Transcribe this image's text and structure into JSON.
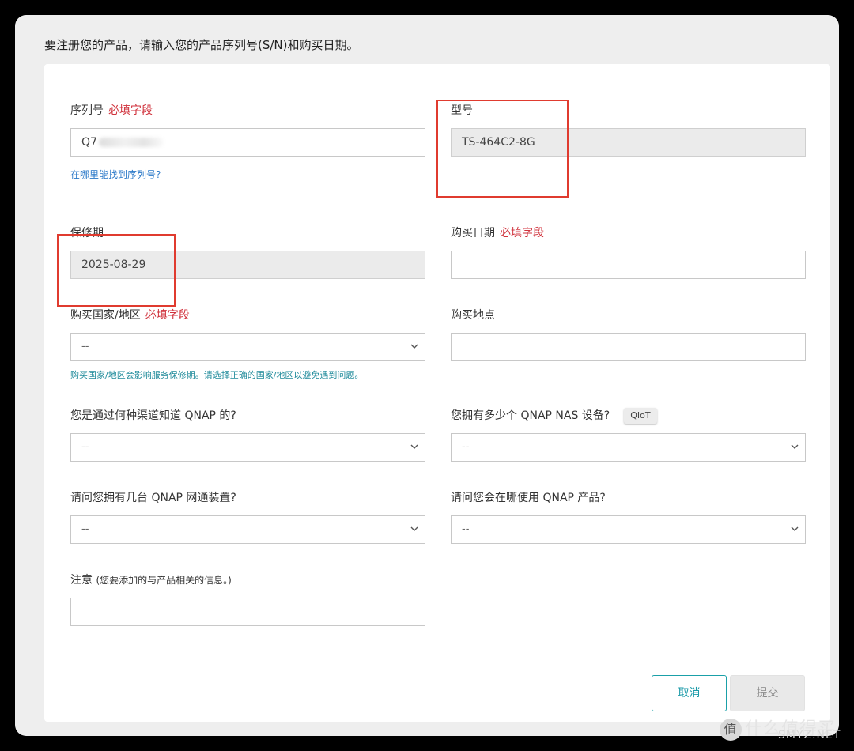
{
  "intro": "要注册您的产品，请输入您的产品序列号(S/N)和购买日期。",
  "required_tag": "必填字段",
  "serial": {
    "label": "序列号",
    "value": "Q7",
    "help_link": "在哪里能找到序列号?"
  },
  "model": {
    "label": "型号",
    "value": "TS-464C2-8G"
  },
  "warranty": {
    "label": "保修期",
    "value": "2025-08-29"
  },
  "purchase_date": {
    "label": "购买日期",
    "value": ""
  },
  "purchase_country": {
    "label": "购买国家/地区",
    "value": "--",
    "hint": "购买国家/地区会影响服务保修期。请选择正确的国家/地区以避免遇到问题。"
  },
  "purchase_place": {
    "label": "购买地点",
    "value": ""
  },
  "channel": {
    "label": "您是通过何种渠道知道 QNAP 的?",
    "value": "--"
  },
  "nas_count": {
    "label": "您拥有多少个 QNAP NAS 设备?",
    "badge": "QIoT",
    "value": "--"
  },
  "network_count": {
    "label": "请问您拥有几台 QNAP 网通装置?",
    "value": "--"
  },
  "usage_place": {
    "label": "请问您会在哪使用 QNAP 产品?",
    "value": "--"
  },
  "notes": {
    "label": "注意",
    "sub": "(您要添加的与产品相关的信息。)",
    "value": ""
  },
  "buttons": {
    "cancel": "取消",
    "submit": "提交"
  },
  "watermark": {
    "logo": "值",
    "text": "什么值得买",
    "site": "SMYZ.NET"
  },
  "colors": {
    "required": "#d0323c",
    "accent": "#1aa0a8",
    "link": "#2a78c8",
    "highlight": "#e03b2f"
  }
}
